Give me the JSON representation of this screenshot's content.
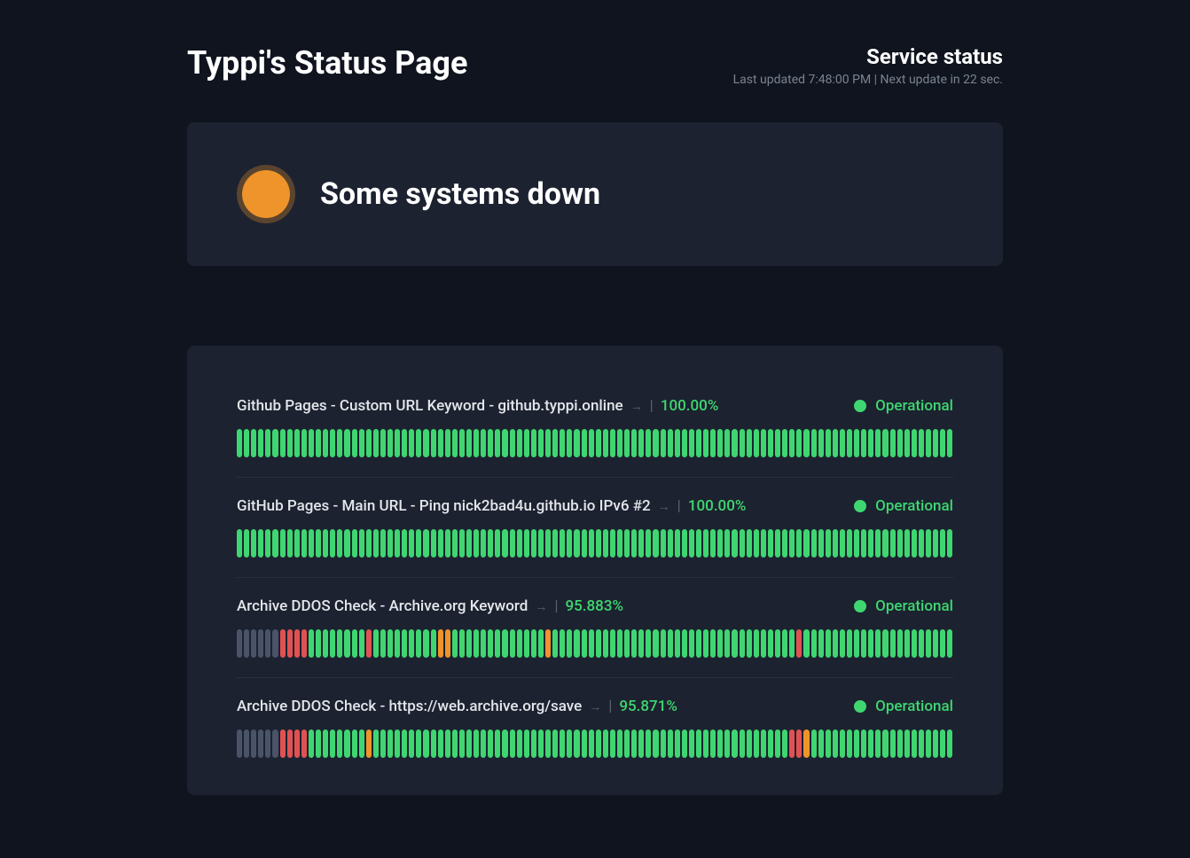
{
  "header": {
    "title": "Typpi's Status Page",
    "statusHeading": "Service status",
    "lastUpdated": "Last updated 7:48:00 PM | Next update in 22 sec."
  },
  "overall": {
    "text": "Some systems down",
    "color": "#ee942a"
  },
  "labels": {
    "operational": "Operational"
  },
  "services": [
    {
      "name": "Github Pages - Custom URL Keyword - github.typpi.online",
      "uptime": "100.00%",
      "status": "Operational",
      "bars": "gggggggggggggggggggggggggggggggggggggggggggggggggggggggggggggggggggggggggggggggggggggggggggggggggggg"
    },
    {
      "name": "GitHub Pages - Main URL - Ping nick2bad4u.github.io IPv6 #2",
      "uptime": "100.00%",
      "status": "Operational",
      "bars": "gggggggggggggggggggggggggggggggggggggggggggggggggggggggggggggggggggggggggggggggggggggggggggggggggggg"
    },
    {
      "name": "Archive DDOS Check - Archive.org Keyword",
      "uptime": "95.883%",
      "status": "Operational",
      "bars": "nnnnnnrrrrggggggggrgggggggggoogggggggggggggoggggggggggggggggggggggggggggggggggrggggggggggggggggggggg"
    },
    {
      "name": "Archive DDOS Check - https://web.archive.org/save",
      "uptime": "95.871%",
      "status": "Operational",
      "bars": "nnnnnnrrrrggggggggoggggggggggggggggggggggggggggggggggggggggggggggggggggggggggrrogggggggggggggggggggg"
    }
  ]
}
